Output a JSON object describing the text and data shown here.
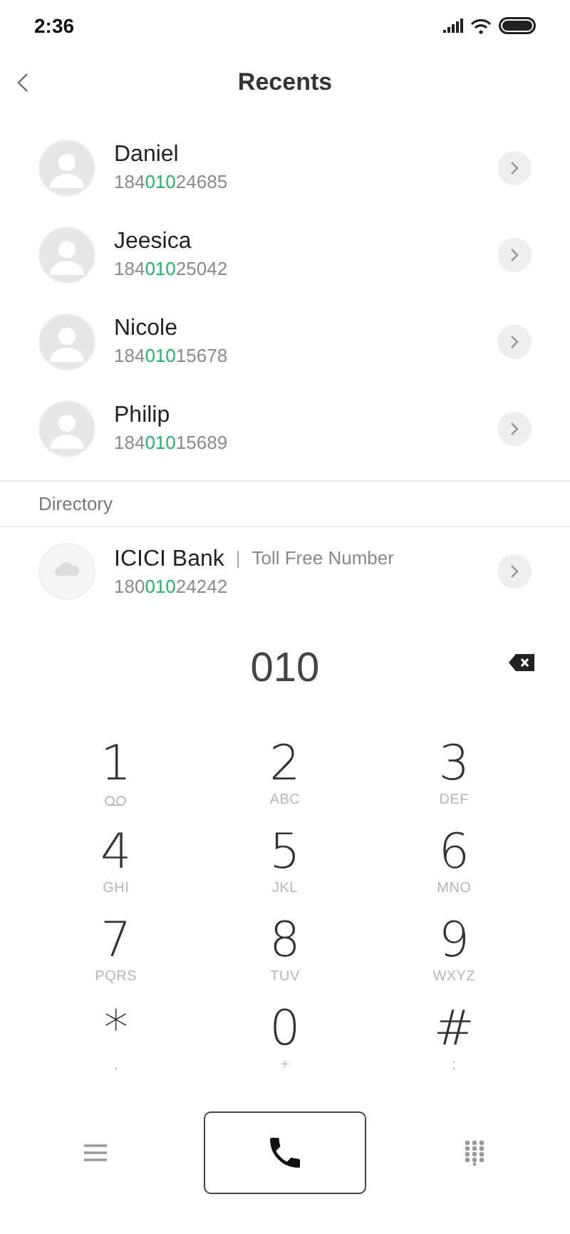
{
  "status_bar": {
    "time": "2:36"
  },
  "header": {
    "title": "Recents"
  },
  "recents": [
    {
      "name": "Daniel",
      "number_start": "184",
      "number_match": "010",
      "number_end": "24685"
    },
    {
      "name": "Jeesica",
      "number_start": "184",
      "number_match": "010",
      "number_end": "25042"
    },
    {
      "name": "Nicole",
      "number_start": "184",
      "number_match": "010",
      "number_end": "15678"
    },
    {
      "name": "Philip",
      "number_start": "184",
      "number_match": "010",
      "number_end": "15689"
    }
  ],
  "directory": {
    "heading": "Directory",
    "entries": [
      {
        "name": "ICICI Bank",
        "separator": "|",
        "tag": "Toll Free Number",
        "number_start": "180",
        "number_match": "010",
        "number_end": "24242"
      }
    ]
  },
  "dialed": "010",
  "keypad": [
    {
      "digit": "1",
      "kind": "voicemail"
    },
    {
      "digit": "2",
      "letters": "ABC",
      "kind": "text"
    },
    {
      "digit": "3",
      "letters": "DEF",
      "kind": "text"
    },
    {
      "digit": "4",
      "letters": "GHI",
      "kind": "text"
    },
    {
      "digit": "5",
      "letters": "JKL",
      "kind": "text"
    },
    {
      "digit": "6",
      "letters": "MNO",
      "kind": "text"
    },
    {
      "digit": "7",
      "letters": "PQRS",
      "kind": "text"
    },
    {
      "digit": "8",
      "letters": "TUV",
      "kind": "text"
    },
    {
      "digit": "9",
      "letters": "WXYZ",
      "kind": "text"
    },
    {
      "digit": "*",
      "letters": ",",
      "kind": "text"
    },
    {
      "digit": "0",
      "letters": "+",
      "kind": "text"
    },
    {
      "digit": "#",
      "letters": ";",
      "kind": "text"
    }
  ]
}
